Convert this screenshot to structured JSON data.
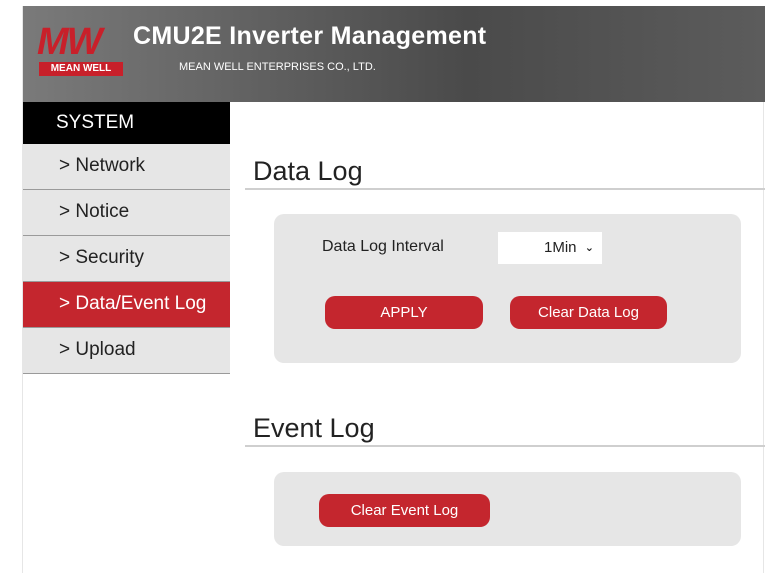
{
  "header": {
    "logo_text": "MW",
    "logo_sub": "MEAN WELL",
    "title": "CMU2E Inverter Management",
    "subtitle": "MEAN WELL ENTERPRISES CO., LTD."
  },
  "sidebar": {
    "heading": "SYSTEM",
    "items": [
      {
        "label": "> Network"
      },
      {
        "label": "> Notice"
      },
      {
        "label": "> Security"
      },
      {
        "label": "> Data/Event Log"
      },
      {
        "label": "> Upload"
      }
    ],
    "active_index": 3
  },
  "data_log": {
    "title": "Data Log",
    "interval_label": "Data Log Interval",
    "interval_value": "1Min",
    "apply_label": "APPLY",
    "clear_label": "Clear Data Log"
  },
  "event_log": {
    "title": "Event Log",
    "clear_label": "Clear Event Log"
  },
  "colors": {
    "accent": "#c4262e",
    "sidebar_bg": "#e6e6e6",
    "sidebar_head": "#000000"
  }
}
